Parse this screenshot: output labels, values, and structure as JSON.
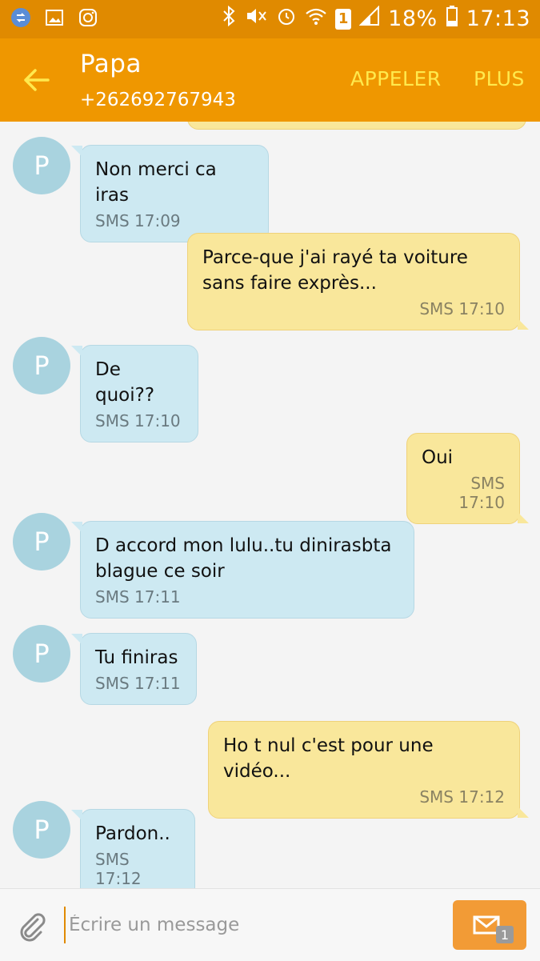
{
  "status_bar": {
    "battery": "18%",
    "time": "17:13",
    "sim_slot": "1",
    "icons": [
      "sync-icon",
      "gallery-icon",
      "instagram-icon",
      "bluetooth-icon",
      "mute-icon",
      "alarm-icon",
      "wifi-icon",
      "signal-icon",
      "battery-icon"
    ]
  },
  "header": {
    "contact_name": "Papa",
    "contact_number": "+262692767943",
    "call_label": "APPELER",
    "more_label": "PLUS"
  },
  "conversation": {
    "avatar_letter": "P",
    "messages": [
      {
        "direction": "in",
        "text": "Non merci ca iras",
        "meta": "SMS 17:09"
      },
      {
        "direction": "out",
        "text": "Parce-que j'ai rayé ta voiture\nsans faire exprès...",
        "meta": "SMS 17:10"
      },
      {
        "direction": "in",
        "text": "De quoi??",
        "meta": "SMS 17:10"
      },
      {
        "direction": "out",
        "text": "Oui",
        "meta": "SMS 17:10"
      },
      {
        "direction": "in",
        "text": "D accord mon lulu..tu dinirasbta\nblague ce soir",
        "meta": "SMS 17:11"
      },
      {
        "direction": "in",
        "text": "Tu finiras",
        "meta": "SMS 17:11"
      },
      {
        "direction": "out",
        "text": "Ho t nul c'est pour une vidéo...",
        "meta": "SMS 17:12"
      },
      {
        "direction": "in",
        "text": "Pardon..",
        "meta": "SMS 17:12"
      }
    ]
  },
  "composer": {
    "placeholder": "Écrire un message",
    "send_badge": "1"
  },
  "colors": {
    "status_bar": "#e08a00",
    "header": "#ef9700",
    "accent_text": "#ffe94d",
    "incoming_bubble": "#cde9f2",
    "outgoing_bubble": "#f9e79b",
    "avatar": "#a9d3df",
    "send_button": "#f29b36"
  }
}
